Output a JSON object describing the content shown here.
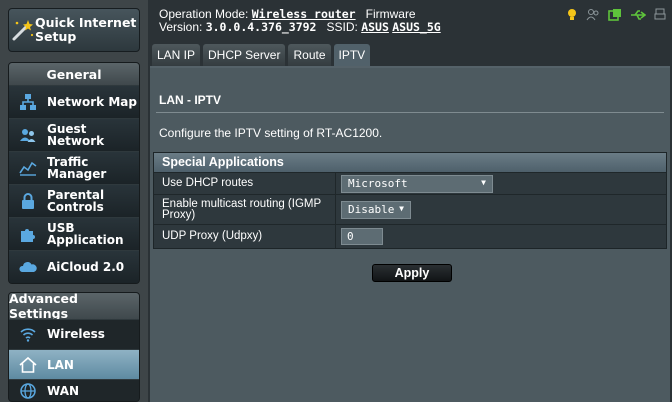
{
  "sidebar": {
    "qis_label": "Quick Internet Setup",
    "general": {
      "header": "General",
      "items": [
        {
          "label": "Network Map"
        },
        {
          "label": "Guest Network"
        },
        {
          "label": "Traffic Manager"
        },
        {
          "label": "Parental Controls"
        },
        {
          "label": "USB Application"
        },
        {
          "label": "AiCloud 2.0"
        }
      ]
    },
    "advanced": {
      "header": "Advanced Settings",
      "items": [
        {
          "label": "Wireless"
        },
        {
          "label": "LAN"
        },
        {
          "label": "WAN"
        }
      ]
    }
  },
  "topbar": {
    "op_mode_label": "Operation Mode:",
    "op_mode_value": "Wireless router",
    "firmware_label": "Firmware",
    "version_label": "Version:",
    "version_value": "3.0.0.4.376_3792",
    "ssid_label": "SSID:",
    "ssid_1": "ASUS",
    "ssid_2": "ASUS_5G"
  },
  "tabs": [
    "LAN IP",
    "DHCP Server",
    "Route",
    "IPTV"
  ],
  "content": {
    "title": "LAN - IPTV",
    "description": "Configure the IPTV setting of RT-AC1200.",
    "section_header": "Special Applications",
    "rows": [
      {
        "label": "Use DHCP routes",
        "value": "Microsoft"
      },
      {
        "label": "Enable multicast routing (IGMP Proxy)",
        "value": "Disable"
      },
      {
        "label": "UDP Proxy (Udpxy)",
        "value": "0"
      }
    ],
    "apply_label": "Apply"
  },
  "colors": {
    "accent_yellow": "#f5c518",
    "accent_green": "#5ec43b",
    "active_nav": "#7aa3b8"
  }
}
